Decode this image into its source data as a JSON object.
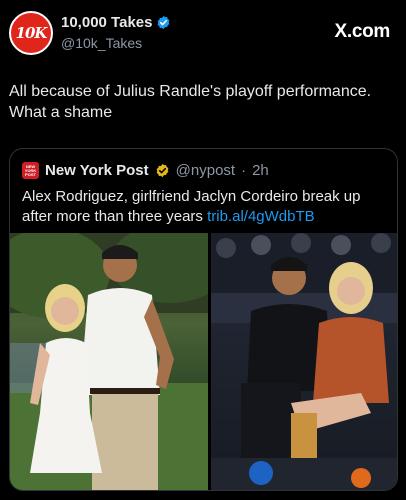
{
  "account": {
    "avatar_text": "10K",
    "display_name": "10,000 Takes",
    "handle": "@10k_Takes"
  },
  "watermark": "X.com",
  "tweet": {
    "text": "All because of Julius Randle's playoff performance. What a shame"
  },
  "quote": {
    "source_name": "New York Post",
    "source_handle": "@nypost",
    "separator": "·",
    "time": "2h",
    "text": "Alex Rodriguez, girlfriend Jaclyn Cordeiro break up after more than three years ",
    "link": "trib.al/4gWdbTB"
  },
  "colors": {
    "brand_red": "#e0251b",
    "verified_blue": "#1d9bf0",
    "gold_check": "#e2b719",
    "link": "#1d9bf0"
  },
  "icons": {
    "verified": "verified-badge-icon",
    "gold_verified": "gold-verified-badge-icon"
  }
}
